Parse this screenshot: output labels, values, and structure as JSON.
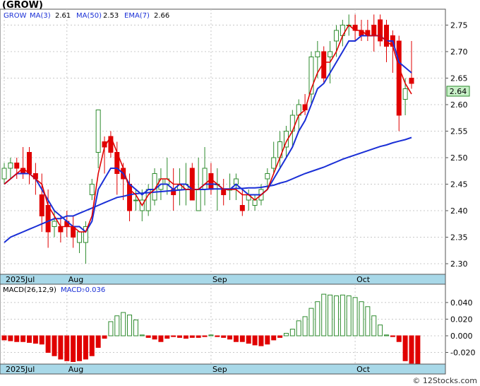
{
  "title": "(GROW)",
  "credit": "© 12Stocks.com",
  "colors": {
    "up": "#2e8b2e",
    "down": "#e00000",
    "ma3": "#e00000",
    "ma50": "#1a2fd6",
    "ema7": "#1a2fd6",
    "axis_band": "#a8d8e8",
    "price_tag": "#c8f0c8",
    "macd_pos": "#2e8b2e",
    "macd_neg": "#e00000",
    "legend_text": "#1a2fd6"
  },
  "chart_data": [
    {
      "type": "candlestick",
      "legend": {
        "ticker": "GROW",
        "ma3": "MA(3)",
        "ma3_val": "2.61",
        "ma50": "MA(50)",
        "ma50_val": "2.53",
        "ema7": "EMA(7)",
        "ema7_val": "2.66"
      },
      "last_price_label": "2.64",
      "ylim": [
        2.28,
        2.78
      ],
      "y_ticks": [
        "2.75",
        "2.70",
        "2.65",
        "2.60",
        "2.55",
        "2.50",
        "2.45",
        "2.40",
        "2.35",
        "2.30"
      ],
      "x_labels": [
        {
          "label": "2025Jul",
          "index": 0
        },
        {
          "label": "Aug",
          "index": 10
        },
        {
          "label": "Sep",
          "index": 33
        },
        {
          "label": "Oct",
          "index": 56
        }
      ],
      "ohlc": [
        [
          2.46,
          2.49,
          2.45,
          2.48
        ],
        [
          2.48,
          2.5,
          2.46,
          2.49
        ],
        [
          2.49,
          2.5,
          2.46,
          2.48
        ],
        [
          2.48,
          2.52,
          2.46,
          2.47
        ],
        [
          2.51,
          2.52,
          2.45,
          2.47
        ],
        [
          2.47,
          2.49,
          2.43,
          2.46
        ],
        [
          2.43,
          2.47,
          2.36,
          2.39
        ],
        [
          2.41,
          2.44,
          2.33,
          2.36
        ],
        [
          2.37,
          2.4,
          2.35,
          2.38
        ],
        [
          2.37,
          2.39,
          2.34,
          2.36
        ],
        [
          2.38,
          2.4,
          2.35,
          2.37
        ],
        [
          2.37,
          2.39,
          2.33,
          2.35
        ],
        [
          2.34,
          2.36,
          2.32,
          2.36
        ],
        [
          2.34,
          2.38,
          2.3,
          2.37
        ],
        [
          2.43,
          2.46,
          2.42,
          2.45
        ],
        [
          2.51,
          2.59,
          2.48,
          2.59
        ],
        [
          2.53,
          2.54,
          2.47,
          2.52
        ],
        [
          2.54,
          2.55,
          2.5,
          2.51
        ],
        [
          2.51,
          2.53,
          2.43,
          2.47
        ],
        [
          2.48,
          2.49,
          2.42,
          2.46
        ],
        [
          2.45,
          2.47,
          2.38,
          2.4
        ],
        [
          2.42,
          2.44,
          2.4,
          2.42
        ],
        [
          2.4,
          2.44,
          2.38,
          2.42
        ],
        [
          2.4,
          2.45,
          2.39,
          2.44
        ],
        [
          2.42,
          2.48,
          2.41,
          2.47
        ],
        [
          2.44,
          2.48,
          2.42,
          2.46
        ],
        [
          2.45,
          2.5,
          2.43,
          2.46
        ],
        [
          2.44,
          2.48,
          2.4,
          2.43
        ],
        [
          2.44,
          2.48,
          2.41,
          2.45
        ],
        [
          2.44,
          2.49,
          2.41,
          2.45
        ],
        [
          2.48,
          2.49,
          2.42,
          2.42
        ],
        [
          2.4,
          2.5,
          2.4,
          2.44
        ],
        [
          2.44,
          2.52,
          2.41,
          2.48
        ],
        [
          2.47,
          2.49,
          2.43,
          2.44
        ],
        [
          2.45,
          2.48,
          2.4,
          2.45
        ],
        [
          2.44,
          2.46,
          2.41,
          2.43
        ],
        [
          2.44,
          2.47,
          2.42,
          2.44
        ],
        [
          2.45,
          2.47,
          2.42,
          2.46
        ],
        [
          2.41,
          2.44,
          2.39,
          2.4
        ],
        [
          2.42,
          2.44,
          2.4,
          2.43
        ],
        [
          2.41,
          2.43,
          2.4,
          2.42
        ],
        [
          2.42,
          2.45,
          2.41,
          2.44
        ],
        [
          2.46,
          2.48,
          2.44,
          2.47
        ],
        [
          2.48,
          2.53,
          2.47,
          2.5
        ],
        [
          2.5,
          2.55,
          2.48,
          2.53
        ],
        [
          2.52,
          2.56,
          2.5,
          2.55
        ],
        [
          2.55,
          2.59,
          2.52,
          2.58
        ],
        [
          2.58,
          2.61,
          2.55,
          2.6
        ],
        [
          2.6,
          2.62,
          2.58,
          2.59
        ],
        [
          2.62,
          2.7,
          2.6,
          2.69
        ],
        [
          2.69,
          2.72,
          2.65,
          2.7
        ],
        [
          2.7,
          2.71,
          2.64,
          2.65
        ],
        [
          2.69,
          2.72,
          2.64,
          2.7
        ],
        [
          2.72,
          2.75,
          2.69,
          2.74
        ],
        [
          2.73,
          2.76,
          2.71,
          2.75
        ],
        [
          2.75,
          2.77,
          2.73,
          2.75
        ],
        [
          2.75,
          2.77,
          2.72,
          2.74
        ],
        [
          2.74,
          2.76,
          2.72,
          2.73
        ],
        [
          2.74,
          2.76,
          2.72,
          2.73
        ],
        [
          2.75,
          2.77,
          2.7,
          2.73
        ],
        [
          2.76,
          2.77,
          2.71,
          2.72
        ],
        [
          2.75,
          2.76,
          2.68,
          2.71
        ],
        [
          2.73,
          2.74,
          2.66,
          2.71
        ],
        [
          2.72,
          2.73,
          2.55,
          2.58
        ],
        [
          2.61,
          2.65,
          2.58,
          2.63
        ],
        [
          2.65,
          2.72,
          2.63,
          2.64
        ]
      ],
      "ma3": [
        2.45,
        2.46,
        2.47,
        2.48,
        2.47,
        2.46,
        2.45,
        2.41,
        2.39,
        2.37,
        2.37,
        2.37,
        2.36,
        2.36,
        2.39,
        2.47,
        2.52,
        2.54,
        2.51,
        2.48,
        2.44,
        2.43,
        2.41,
        2.43,
        2.44,
        2.46,
        2.46,
        2.45,
        2.45,
        2.44,
        2.44,
        2.44,
        2.45,
        2.46,
        2.45,
        2.44,
        2.44,
        2.44,
        2.43,
        2.43,
        2.42,
        2.43,
        2.44,
        2.47,
        2.5,
        2.53,
        2.55,
        2.58,
        2.59,
        2.63,
        2.66,
        2.68,
        2.68,
        2.7,
        2.73,
        2.75,
        2.74,
        2.74,
        2.73,
        2.73,
        2.73,
        2.72,
        2.71,
        2.67,
        2.64,
        2.62
      ],
      "ema7": [
        2.45,
        2.46,
        2.47,
        2.47,
        2.47,
        2.46,
        2.44,
        2.42,
        2.4,
        2.39,
        2.38,
        2.37,
        2.37,
        2.36,
        2.38,
        2.44,
        2.46,
        2.48,
        2.48,
        2.47,
        2.45,
        2.44,
        2.43,
        2.44,
        2.44,
        2.45,
        2.45,
        2.44,
        2.45,
        2.45,
        2.44,
        2.44,
        2.45,
        2.45,
        2.45,
        2.44,
        2.44,
        2.45,
        2.44,
        2.43,
        2.43,
        2.43,
        2.44,
        2.46,
        2.48,
        2.5,
        2.52,
        2.55,
        2.57,
        2.6,
        2.63,
        2.64,
        2.66,
        2.68,
        2.7,
        2.72,
        2.72,
        2.73,
        2.73,
        2.73,
        2.73,
        2.72,
        2.72,
        2.68,
        2.67,
        2.66
      ],
      "ma50": [
        2.34,
        2.35,
        2.355,
        2.36,
        2.365,
        2.37,
        2.375,
        2.38,
        2.385,
        2.385,
        2.39,
        2.39,
        2.395,
        2.4,
        2.405,
        2.41,
        2.415,
        2.42,
        2.425,
        2.427,
        2.43,
        2.432,
        2.433,
        2.434,
        2.435,
        2.436,
        2.437,
        2.438,
        2.439,
        2.44,
        2.44,
        2.44,
        2.44,
        2.441,
        2.441,
        2.441,
        2.441,
        2.442,
        2.442,
        2.443,
        2.443,
        2.444,
        2.446,
        2.448,
        2.452,
        2.455,
        2.46,
        2.465,
        2.47,
        2.474,
        2.478,
        2.482,
        2.487,
        2.492,
        2.497,
        2.501,
        2.505,
        2.509,
        2.513,
        2.517,
        2.521,
        2.524,
        2.528,
        2.531,
        2.534,
        2.538
      ]
    },
    {
      "type": "bar",
      "legend": {
        "name": "MACD(26,12,9)",
        "label": "MACD:",
        "value": "-0.036"
      },
      "ylim": [
        -0.034,
        0.062
      ],
      "y_ticks": [
        "0.040",
        "0.020",
        "0.000",
        "-0.020"
      ],
      "x_labels": [
        {
          "label": "2025Jul",
          "index": 0
        },
        {
          "label": "Aug",
          "index": 10
        },
        {
          "label": "Sep",
          "index": 33
        },
        {
          "label": "Oct",
          "index": 56
        }
      ],
      "values": [
        -0.005,
        -0.006,
        -0.007,
        -0.007,
        -0.008,
        -0.009,
        -0.01,
        -0.02,
        -0.024,
        -0.028,
        -0.03,
        -0.031,
        -0.03,
        -0.028,
        -0.024,
        -0.014,
        -0.003,
        0.017,
        0.024,
        0.028,
        0.025,
        0.019,
        0.001,
        -0.002,
        -0.004,
        -0.007,
        -0.003,
        -0.001,
        -0.002,
        -0.003,
        -0.002,
        -0.002,
        -0.001,
        0.001,
        -0.001,
        -0.002,
        -0.004,
        -0.007,
        -0.007,
        -0.009,
        -0.011,
        -0.012,
        -0.01,
        -0.005,
        -0.002,
        0.003,
        0.008,
        0.018,
        0.023,
        0.033,
        0.041,
        0.05,
        0.049,
        0.048,
        0.049,
        0.048,
        0.046,
        0.041,
        0.035,
        0.024,
        0.013,
        0.001,
        -0.001,
        -0.007,
        -0.03,
        -0.033,
        -0.036
      ]
    }
  ]
}
